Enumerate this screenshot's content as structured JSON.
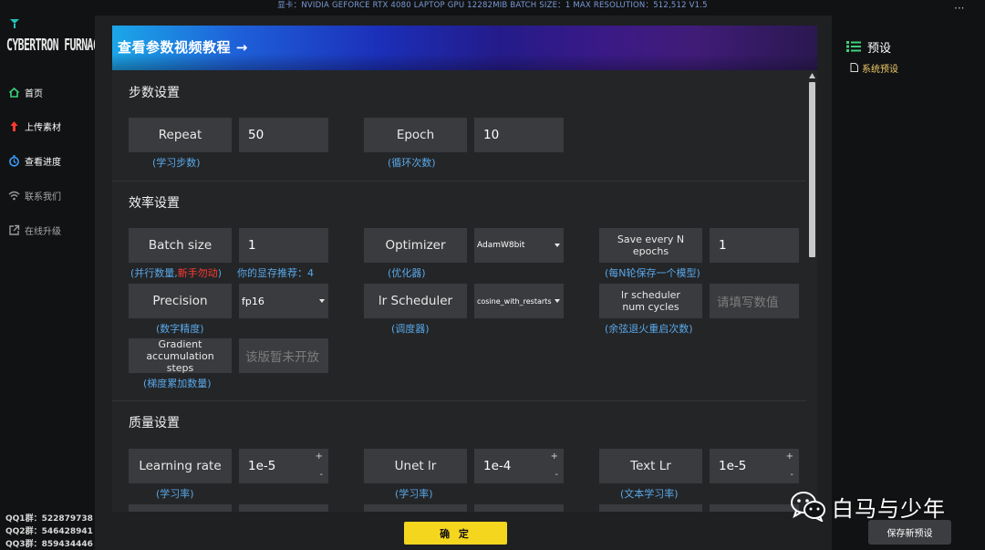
{
  "gpu_info": "显卡：NVIDIA GEFORCE RTX 4080 LAPTOP GPU 12282MIB  BATCH SIZE：1  MAX RESOLUTION：512,512 V1.5",
  "app": {
    "logo_text": "CYBERTRON FURNACE"
  },
  "sidebar": {
    "items": [
      {
        "label": "首页",
        "icon": "home-icon"
      },
      {
        "label": "上传素材",
        "icon": "upload-arrow-icon"
      },
      {
        "label": "查看进度",
        "icon": "timer-icon"
      },
      {
        "label": "联系我们",
        "icon": "wifi-icon"
      },
      {
        "label": "在线升级",
        "icon": "external-link-icon"
      }
    ],
    "qq": [
      "QQ1群：522879738",
      "QQ2群：546428941",
      "QQ3群：859434446"
    ]
  },
  "banner": {
    "text": "查看参数视频教程 →"
  },
  "sections": {
    "steps": {
      "title": "步数设置",
      "repeat": {
        "label": "Repeat",
        "value": "50",
        "hint": "(学习步数)"
      },
      "epoch": {
        "label": "Epoch",
        "value": "10",
        "hint": "(循环次数)"
      }
    },
    "efficiency": {
      "title": "效率设置",
      "batch_size": {
        "label": "Batch size",
        "value": "1",
        "hint_prefix": "(并行数量,",
        "hint_warn": "新手勿动",
        "hint_suffix": ")",
        "vram_hint": "你的显存推荐：4"
      },
      "optimizer": {
        "label": "Optimizer",
        "value": "AdamW8bit",
        "hint": "(优化器)"
      },
      "save_every": {
        "label": "Save every N epochs",
        "value": "1",
        "hint": "(每N轮保存一个模型)"
      },
      "precision": {
        "label": "Precision",
        "value": "fp16",
        "hint": "(数字精度)"
      },
      "lr_scheduler": {
        "label": "lr Scheduler",
        "value": "cosine_with_restarts",
        "hint": "(调度器)"
      },
      "lr_cycles": {
        "label": "lr scheduler num cycles",
        "placeholder": "请填写数值",
        "hint": "(余弦退火重启次数)"
      },
      "grad_accum": {
        "label": "Gradient accumulation steps",
        "value": "该版暂未开放",
        "hint": "(梯度累加数量)"
      }
    },
    "quality": {
      "title": "质量设置",
      "learning_rate": {
        "label": "Learning rate",
        "value": "1e-5",
        "hint": "(学习率)"
      },
      "unet_lr": {
        "label": "Unet lr",
        "value": "1e-4",
        "hint": "(学习率)"
      },
      "text_lr": {
        "label": "Text Lr",
        "value": "1e-5",
        "hint": "(文本学习率)"
      }
    }
  },
  "spin": {
    "up": "+",
    "down": "-"
  },
  "confirm_label": "确 定",
  "right_panel": {
    "title": "预设",
    "items": [
      "系统预设"
    ],
    "more": "···"
  },
  "watermark": "白马与少年",
  "save_preset_label": "保存新预设",
  "colors": {
    "accent": "#f5d61f",
    "hint": "#58a8e8",
    "warn": "#ff3b30",
    "preset": "#f0c96a"
  }
}
